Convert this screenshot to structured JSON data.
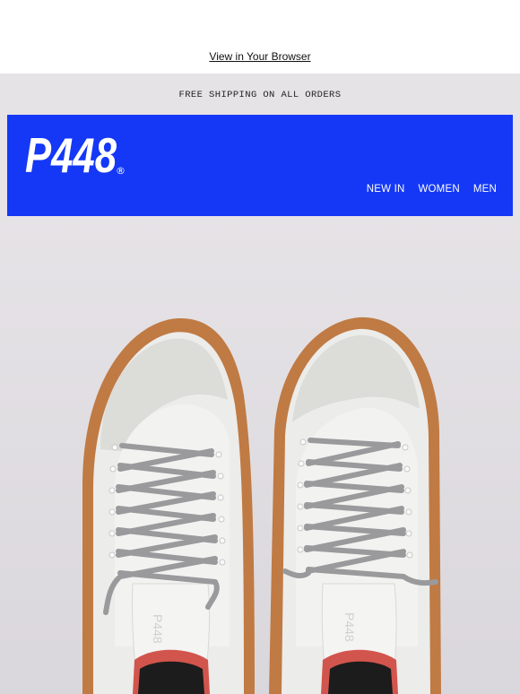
{
  "preheader": {
    "view_in_browser_label": "View in Your Browser"
  },
  "banner": {
    "shipping_text": "FREE SHIPPING ON ALL ORDERS"
  },
  "header": {
    "logo_text": "P448",
    "logo_mark": "®",
    "nav": [
      {
        "label": "NEW IN"
      },
      {
        "label": "WOMEN"
      },
      {
        "label": "MEN"
      }
    ]
  },
  "hero": {
    "image_subject": "pair of white sneakers with grey laces and gum soles, top view",
    "tongue_label": "P448"
  },
  "colors": {
    "brand_blue": "#1438f5",
    "background": "#e6e3e6",
    "sole": "#c07a43",
    "lace": "#9a9a9d",
    "lining_red": "#d2554d"
  }
}
